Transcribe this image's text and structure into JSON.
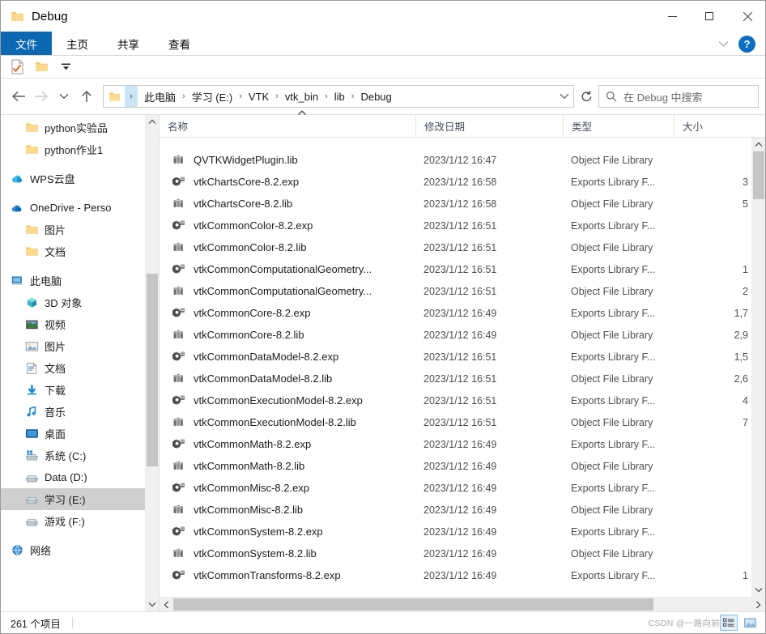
{
  "window": {
    "title": "Debug",
    "title_icon": "folder-icon",
    "minimize_label": "—",
    "maximize_label": "□",
    "close_label": "✕"
  },
  "ribbon": {
    "tabs": [
      {
        "label": "文件",
        "active": true
      },
      {
        "label": "主页",
        "active": false
      },
      {
        "label": "共享",
        "active": false
      },
      {
        "label": "查看",
        "active": false
      }
    ],
    "expand_icon": "chevron-down-icon",
    "help_label": "?"
  },
  "quick_access": {
    "items": [
      {
        "name": "properties-icon"
      },
      {
        "name": "new-folder-icon"
      },
      {
        "name": "customize-dropdown-icon"
      }
    ]
  },
  "address_bar": {
    "back_icon": "arrow-left-icon",
    "forward_icon": "arrow-right-icon",
    "recent_icon": "chevron-down-icon",
    "up_icon": "arrow-up-icon",
    "path_icon": "folder-icon",
    "crumbs": [
      "此电脑",
      "学习 (E:)",
      "VTK",
      "vtk_bin",
      "lib",
      "Debug"
    ],
    "separator": "›",
    "dropdown_icon": "chevron-down-icon",
    "refresh_icon": "refresh-icon",
    "search": {
      "icon": "search-icon",
      "placeholder": "在 Debug 中搜索",
      "value": ""
    }
  },
  "sidebar": {
    "items": [
      {
        "label": "python实验品",
        "icon": "folder-icon",
        "indent": 1,
        "selected": false
      },
      {
        "label": "python作业1",
        "icon": "folder-icon",
        "indent": 1,
        "selected": false
      },
      {
        "label": "",
        "icon": "spacer",
        "indent": 0,
        "selected": false
      },
      {
        "label": "WPS云盘",
        "icon": "wps-cloud-icon",
        "indent": 0,
        "selected": false
      },
      {
        "label": "",
        "icon": "spacer",
        "indent": 0,
        "selected": false
      },
      {
        "label": "OneDrive - Perso",
        "icon": "onedrive-icon",
        "indent": 0,
        "selected": false
      },
      {
        "label": "图片",
        "icon": "folder-icon",
        "indent": 1,
        "selected": false
      },
      {
        "label": "文档",
        "icon": "folder-icon",
        "indent": 1,
        "selected": false
      },
      {
        "label": "",
        "icon": "spacer",
        "indent": 0,
        "selected": false
      },
      {
        "label": "此电脑",
        "icon": "this-pc-icon",
        "indent": 0,
        "selected": false
      },
      {
        "label": "3D 对象",
        "icon": "3d-objects-icon",
        "indent": 1,
        "selected": false
      },
      {
        "label": "视频",
        "icon": "videos-icon",
        "indent": 1,
        "selected": false
      },
      {
        "label": "图片",
        "icon": "pictures-icon",
        "indent": 1,
        "selected": false
      },
      {
        "label": "文档",
        "icon": "documents-icon",
        "indent": 1,
        "selected": false
      },
      {
        "label": "下载",
        "icon": "downloads-icon",
        "indent": 1,
        "selected": false
      },
      {
        "label": "音乐",
        "icon": "music-icon",
        "indent": 1,
        "selected": false
      },
      {
        "label": "桌面",
        "icon": "desktop-icon",
        "indent": 1,
        "selected": false
      },
      {
        "label": "系统 (C:)",
        "icon": "system-drive-icon",
        "indent": 1,
        "selected": false
      },
      {
        "label": "Data (D:)",
        "icon": "drive-icon",
        "indent": 1,
        "selected": false
      },
      {
        "label": "学习 (E:)",
        "icon": "drive-icon",
        "indent": 1,
        "selected": true
      },
      {
        "label": "游戏 (F:)",
        "icon": "drive-icon",
        "indent": 1,
        "selected": false
      },
      {
        "label": "",
        "icon": "spacer",
        "indent": 0,
        "selected": false
      },
      {
        "label": "网络",
        "icon": "network-icon",
        "indent": 0,
        "selected": false
      }
    ],
    "scroll_up_icon": "chevron-up-icon",
    "scroll_down_icon": "chevron-down-icon"
  },
  "file_list": {
    "columns": [
      {
        "label": "名称",
        "sorted": "asc"
      },
      {
        "label": "修改日期",
        "sorted": ""
      },
      {
        "label": "类型",
        "sorted": ""
      },
      {
        "label": "大小",
        "sorted": ""
      }
    ],
    "sort_icon": "caret-up-icon",
    "rows": [
      {
        "name": " ",
        "date": " ",
        "type": " ",
        "size": "",
        "icon": "clipped-row"
      },
      {
        "name": "QVTKWidgetPlugin.lib",
        "date": "2023/1/12 16:47",
        "type": "Object File Library",
        "size": "",
        "icon": "lib-file-icon"
      },
      {
        "name": "vtkChartsCore-8.2.exp",
        "date": "2023/1/12 16:58",
        "type": "Exports Library F...",
        "size": "3",
        "icon": "exp-file-icon"
      },
      {
        "name": "vtkChartsCore-8.2.lib",
        "date": "2023/1/12 16:58",
        "type": "Object File Library",
        "size": "5",
        "icon": "lib-file-icon"
      },
      {
        "name": "vtkCommonColor-8.2.exp",
        "date": "2023/1/12 16:51",
        "type": "Exports Library F...",
        "size": "",
        "icon": "exp-file-icon"
      },
      {
        "name": "vtkCommonColor-8.2.lib",
        "date": "2023/1/12 16:51",
        "type": "Object File Library",
        "size": "",
        "icon": "lib-file-icon"
      },
      {
        "name": "vtkCommonComputationalGeometry...",
        "date": "2023/1/12 16:51",
        "type": "Exports Library F...",
        "size": "1",
        "icon": "exp-file-icon"
      },
      {
        "name": "vtkCommonComputationalGeometry...",
        "date": "2023/1/12 16:51",
        "type": "Object File Library",
        "size": "2",
        "icon": "lib-file-icon"
      },
      {
        "name": "vtkCommonCore-8.2.exp",
        "date": "2023/1/12 16:49",
        "type": "Exports Library F...",
        "size": "1,7",
        "icon": "exp-file-icon"
      },
      {
        "name": "vtkCommonCore-8.2.lib",
        "date": "2023/1/12 16:49",
        "type": "Object File Library",
        "size": "2,9",
        "icon": "lib-file-icon"
      },
      {
        "name": "vtkCommonDataModel-8.2.exp",
        "date": "2023/1/12 16:51",
        "type": "Exports Library F...",
        "size": "1,5",
        "icon": "exp-file-icon"
      },
      {
        "name": "vtkCommonDataModel-8.2.lib",
        "date": "2023/1/12 16:51",
        "type": "Object File Library",
        "size": "2,6",
        "icon": "lib-file-icon"
      },
      {
        "name": "vtkCommonExecutionModel-8.2.exp",
        "date": "2023/1/12 16:51",
        "type": "Exports Library F...",
        "size": "4",
        "icon": "exp-file-icon"
      },
      {
        "name": "vtkCommonExecutionModel-8.2.lib",
        "date": "2023/1/12 16:51",
        "type": "Object File Library",
        "size": "7",
        "icon": "lib-file-icon"
      },
      {
        "name": "vtkCommonMath-8.2.exp",
        "date": "2023/1/12 16:49",
        "type": "Exports Library F...",
        "size": "",
        "icon": "exp-file-icon"
      },
      {
        "name": "vtkCommonMath-8.2.lib",
        "date": "2023/1/12 16:49",
        "type": "Object File Library",
        "size": "",
        "icon": "lib-file-icon"
      },
      {
        "name": "vtkCommonMisc-8.2.exp",
        "date": "2023/1/12 16:49",
        "type": "Exports Library F...",
        "size": "",
        "icon": "exp-file-icon"
      },
      {
        "name": "vtkCommonMisc-8.2.lib",
        "date": "2023/1/12 16:49",
        "type": "Object File Library",
        "size": "",
        "icon": "lib-file-icon"
      },
      {
        "name": "vtkCommonSystem-8.2.exp",
        "date": "2023/1/12 16:49",
        "type": "Exports Library F...",
        "size": "",
        "icon": "exp-file-icon"
      },
      {
        "name": "vtkCommonSystem-8.2.lib",
        "date": "2023/1/12 16:49",
        "type": "Object File Library",
        "size": "",
        "icon": "lib-file-icon"
      },
      {
        "name": "vtkCommonTransforms-8.2.exp",
        "date": "2023/1/12 16:49",
        "type": "Exports Library F...",
        "size": "1",
        "icon": "exp-file-icon"
      }
    ],
    "h_scroll_left_icon": "chevron-left-icon",
    "h_scroll_right_icon": "chevron-right-icon"
  },
  "status_bar": {
    "item_count": "261 个项目",
    "watermark": "CSDN @一路向前",
    "details_view_icon": "details-view-icon",
    "large_icons_view_icon": "large-icons-view-icon"
  },
  "colors": {
    "accent": "#0d68b4",
    "selection": "#cfcfcf",
    "hover": "#e9f3fc",
    "help_blue": "#0b6ec1",
    "folder_yellow": "#f6c968"
  }
}
